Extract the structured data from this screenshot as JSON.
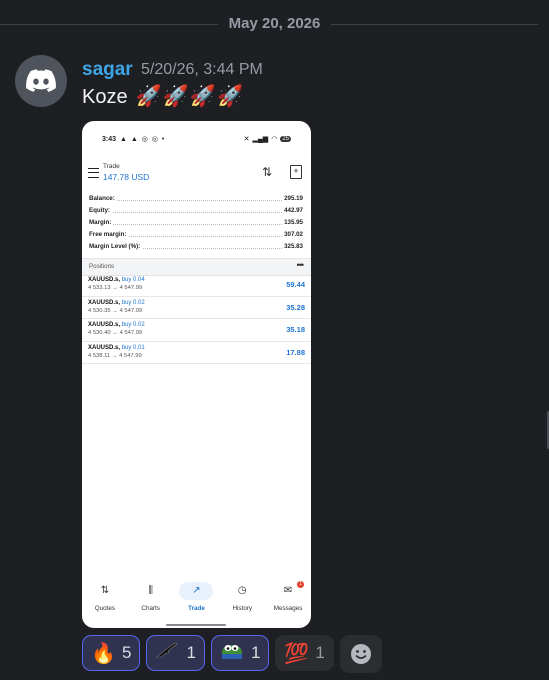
{
  "divider": {
    "date": "May 20, 2026"
  },
  "message": {
    "username": "sagar",
    "timestamp": "5/20/26, 3:44 PM",
    "text": "Koze",
    "rockets": [
      "🚀",
      "🚀",
      "🚀",
      "🚀"
    ]
  },
  "screenshot": {
    "status": {
      "time": "3:43",
      "left_icons": "▲ ▲ ◎ ◎ •",
      "battery": "25"
    },
    "header": {
      "title": "Trade",
      "amount": "147.78 USD"
    },
    "account": [
      {
        "label": "Balance:",
        "value": "295.19"
      },
      {
        "label": "Equity:",
        "value": "442.97"
      },
      {
        "label": "Margin:",
        "value": "135.95"
      },
      {
        "label": "Free margin:",
        "value": "307.02"
      },
      {
        "label": "Margin Level (%):",
        "value": "325.83"
      }
    ],
    "positions_label": "Positions",
    "positions": [
      {
        "symbol": "XAUUSD.s,",
        "side": "buy 0.04",
        "prices": "4 533.13 → 4 547.99",
        "profit": "59.44"
      },
      {
        "symbol": "XAUUSD.s,",
        "side": "buy 0.02",
        "prices": "4 530.35 → 4 547.99",
        "profit": "35.28"
      },
      {
        "symbol": "XAUUSD.s,",
        "side": "buy 0.02",
        "prices": "4 530.40 → 4 547.99",
        "profit": "35.18"
      },
      {
        "symbol": "XAUUSD.s,",
        "side": "buy 0.01",
        "prices": "4 538.11 → 4 547.99",
        "profit": "17.88"
      }
    ],
    "nav": [
      {
        "label": "Quotes",
        "icon": "quotes-icon",
        "glyph": "⇅",
        "active": false
      },
      {
        "label": "Charts",
        "icon": "charts-icon",
        "glyph": "⫼",
        "active": false
      },
      {
        "label": "Trade",
        "icon": "trade-icon",
        "glyph": "↗",
        "active": true
      },
      {
        "label": "History",
        "icon": "history-icon",
        "glyph": "◷",
        "active": false
      },
      {
        "label": "Messages",
        "icon": "messages-icon",
        "glyph": "✉",
        "active": false,
        "badge": "1"
      }
    ]
  },
  "reactions": [
    {
      "emoji": "🔥",
      "count": "5",
      "me": true,
      "name": "reaction-fire"
    },
    {
      "emoji": "╾━",
      "count": "1",
      "me": true,
      "name": "reaction-rifle"
    },
    {
      "emoji": "🐸",
      "count": "1",
      "me": true,
      "name": "reaction-pepe"
    },
    {
      "emoji": "💯",
      "count": "1",
      "me": false,
      "name": "reaction-hundred"
    }
  ],
  "colors": {
    "username": "#3ea6e8",
    "accent": "#5865f2",
    "profit": "#1f74d1"
  }
}
